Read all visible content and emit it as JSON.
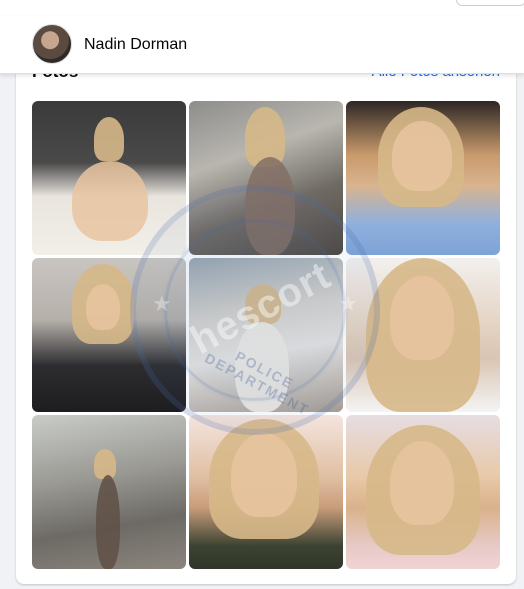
{
  "header": {
    "profile_name": "Nadin Dorman"
  },
  "photos_card": {
    "title": "Fotos",
    "see_all_label": "Alle Fotos ansehen"
  },
  "photos": [
    {
      "label": "photo-1"
    },
    {
      "label": "photo-2"
    },
    {
      "label": "photo-3"
    },
    {
      "label": "photo-4"
    },
    {
      "label": "photo-5"
    },
    {
      "label": "photo-6"
    },
    {
      "label": "photo-7"
    },
    {
      "label": "photo-8"
    },
    {
      "label": "photo-9"
    }
  ],
  "watermark": {
    "text": "hescort",
    "subtext": "POLICE DEPARTMENT"
  },
  "colors": {
    "link": "#216fdb",
    "background": "#f0f2f5",
    "card": "#ffffff"
  }
}
